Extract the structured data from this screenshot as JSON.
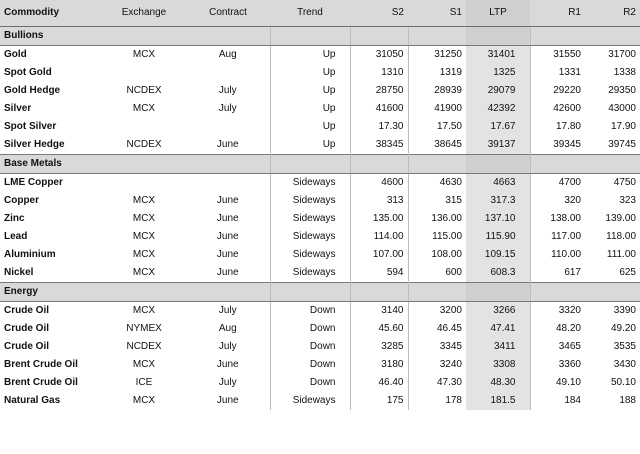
{
  "columns": {
    "commodity": "Commodity",
    "exchange": "Exchange",
    "contract": "Contract",
    "trend": "Trend",
    "s2": "S2",
    "s1": "S1",
    "ltp": "LTP",
    "r1": "R1",
    "r2": "R2"
  },
  "sections": [
    {
      "title": "Bullions",
      "rows": [
        {
          "commodity": "Gold",
          "exchange": "MCX",
          "contract": "Aug",
          "trend": "Up",
          "s2": "31050",
          "s1": "31250",
          "ltp": "31401",
          "r1": "31550",
          "r2": "31700"
        },
        {
          "commodity": "Spot Gold",
          "exchange": "",
          "contract": "",
          "trend": "Up",
          "s2": "1310",
          "s1": "1319",
          "ltp": "1325",
          "r1": "1331",
          "r2": "1338"
        },
        {
          "commodity": "Gold Hedge",
          "exchange": "NCDEX",
          "contract": "July",
          "trend": "Up",
          "s2": "28750",
          "s1": "28939",
          "ltp": "29079",
          "r1": "29220",
          "r2": "29350"
        },
        {
          "commodity": "Silver",
          "exchange": "MCX",
          "contract": "July",
          "trend": "Up",
          "s2": "41600",
          "s1": "41900",
          "ltp": "42392",
          "r1": "42600",
          "r2": "43000"
        },
        {
          "commodity": "Spot Silver",
          "exchange": "",
          "contract": "",
          "trend": "Up",
          "s2": "17.30",
          "s1": "17.50",
          "ltp": "17.67",
          "r1": "17.80",
          "r2": "17.90"
        },
        {
          "commodity": "Silver Hedge",
          "exchange": "NCDEX",
          "contract": "June",
          "trend": "Up",
          "s2": "38345",
          "s1": "38645",
          "ltp": "39137",
          "r1": "39345",
          "r2": "39745"
        }
      ]
    },
    {
      "title": "Base Metals",
      "rows": [
        {
          "commodity": "LME Copper",
          "exchange": "",
          "contract": "",
          "trend": "Sideways",
          "s2": "4600",
          "s1": "4630",
          "ltp": "4663",
          "r1": "4700",
          "r2": "4750"
        },
        {
          "commodity": "Copper",
          "exchange": "MCX",
          "contract": "June",
          "trend": "Sideways",
          "s2": "313",
          "s1": "315",
          "ltp": "317.3",
          "r1": "320",
          "r2": "323"
        },
        {
          "commodity": "Zinc",
          "exchange": "MCX",
          "contract": "June",
          "trend": "Sideways",
          "s2": "135.00",
          "s1": "136.00",
          "ltp": "137.10",
          "r1": "138.00",
          "r2": "139.00"
        },
        {
          "commodity": "Lead",
          "exchange": "MCX",
          "contract": "June",
          "trend": "Sideways",
          "s2": "114.00",
          "s1": "115.00",
          "ltp": "115.90",
          "r1": "117.00",
          "r2": "118.00"
        },
        {
          "commodity": "Aluminium",
          "exchange": "MCX",
          "contract": "June",
          "trend": "Sideways",
          "s2": "107.00",
          "s1": "108.00",
          "ltp": "109.15",
          "r1": "110.00",
          "r2": "111.00"
        },
        {
          "commodity": "Nickel",
          "exchange": "MCX",
          "contract": "June",
          "trend": "Sideways",
          "s2": "594",
          "s1": "600",
          "ltp": "608.3",
          "r1": "617",
          "r2": "625"
        }
      ]
    },
    {
      "title": "Energy",
      "rows": [
        {
          "commodity": "Crude Oil",
          "exchange": "MCX",
          "contract": "July",
          "trend": "Down",
          "s2": "3140",
          "s1": "3200",
          "ltp": "3266",
          "r1": "3320",
          "r2": "3390"
        },
        {
          "commodity": "Crude Oil",
          "exchange": "NYMEX",
          "contract": "Aug",
          "trend": "Down",
          "s2": "45.60",
          "s1": "46.45",
          "ltp": "47.41",
          "r1": "48.20",
          "r2": "49.20"
        },
        {
          "commodity": "Crude Oil",
          "exchange": "NCDEX",
          "contract": "July",
          "trend": "Down",
          "s2": "3285",
          "s1": "3345",
          "ltp": "3411",
          "r1": "3465",
          "r2": "3535"
        },
        {
          "commodity": "Brent Crude Oil",
          "exchange": "MCX",
          "contract": "June",
          "trend": "Down",
          "s2": "3180",
          "s1": "3240",
          "ltp": "3308",
          "r1": "3360",
          "r2": "3430"
        },
        {
          "commodity": "Brent Crude Oil",
          "exchange": "ICE",
          "contract": "July",
          "trend": "Down",
          "s2": "46.40",
          "s1": "47.30",
          "ltp": "48.30",
          "r1": "49.10",
          "r2": "50.10"
        },
        {
          "commodity": "Natural Gas",
          "exchange": "MCX",
          "contract": "June",
          "trend": "Sideways",
          "s2": "175",
          "s1": "178",
          "ltp": "181.5",
          "r1": "184",
          "r2": "188"
        }
      ]
    }
  ]
}
